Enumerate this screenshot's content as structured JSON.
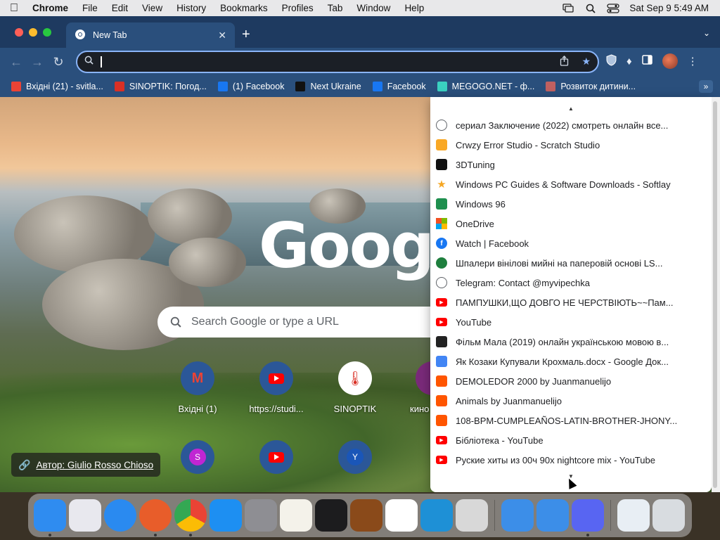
{
  "menubar": {
    "app_name": "Chrome",
    "items": [
      "File",
      "Edit",
      "View",
      "History",
      "Bookmarks",
      "Profiles",
      "Tab",
      "Window",
      "Help"
    ],
    "datetime": "Sat Sep 9  5:49 AM"
  },
  "tab": {
    "title": "New Tab"
  },
  "omnibox": {
    "value": ""
  },
  "bookmarks_bar": [
    {
      "label": "Вхідні (21) - svitla...",
      "icon": "gmail-icon",
      "color": "#ea4335"
    },
    {
      "label": "SINOPTIK: Погод...",
      "icon": "thermometer-icon",
      "color": "#d93025"
    },
    {
      "label": "(1) Facebook",
      "icon": "facebook-icon",
      "color": "#1877f2"
    },
    {
      "label": "Next Ukraine",
      "icon": "next-ukraine-icon",
      "color": "#111111"
    },
    {
      "label": "Facebook",
      "icon": "facebook-icon",
      "color": "#1877f2"
    },
    {
      "label": "MEGOGO.NET - ф...",
      "icon": "megogo-icon",
      "color": "#3ad1c1"
    },
    {
      "label": "Розвиток дитини...",
      "icon": "baby-icon",
      "color": "#c06060"
    }
  ],
  "new_tab_page": {
    "logo": "Google",
    "search_placeholder": "Search Google or type a URL",
    "shortcuts_row1": [
      "Вхідні (1)",
      "https://studi...",
      "SINOPTIK",
      "кино"
    ],
    "shortcuts_row2_initials": [
      "S",
      "Y"
    ],
    "photo_credit": "Автор: Giulio Rosso Chioso"
  },
  "dropdown_items": [
    {
      "label": "сериал Заключение (2022) смотреть онлайн все...",
      "icon": "globe-icon",
      "color": "#5f6368"
    },
    {
      "label": "Crwzy Error Studio - Scratch Studio",
      "icon": "scratch-icon",
      "color": "#f9a825"
    },
    {
      "label": "3DTuning",
      "icon": "3dtuning-icon",
      "color": "#111111"
    },
    {
      "label": "Windows PC Guides & Software Downloads - Softlay",
      "icon": "star-icon",
      "color": "#f5a623"
    },
    {
      "label": "Windows 96",
      "icon": "windows96-icon",
      "color": "#1e8f4e"
    },
    {
      "label": "OneDrive",
      "icon": "microsoft-icon",
      "color": "#f25022"
    },
    {
      "label": "Watch | Facebook",
      "icon": "facebook-icon",
      "color": "#1877f2"
    },
    {
      "label": "Шпалери вінілові мийні на паперовій основі LS...",
      "icon": "green-circle-icon",
      "color": "#1e7f3e"
    },
    {
      "label": "Telegram: Contact @myvipechka",
      "icon": "globe-icon",
      "color": "#5f6368"
    },
    {
      "label": "ПАМПУШКИ,ЩО ДОВГО НЕ ЧЕРСТВІЮТЬ~~Пам...",
      "icon": "youtube-icon",
      "color": "#ff0000"
    },
    {
      "label": "YouTube",
      "icon": "youtube-icon",
      "color": "#ff0000"
    },
    {
      "label": "Фільм Мала (2019) онлайн українською мовою в...",
      "icon": "film-icon",
      "color": "#222222"
    },
    {
      "label": "Як Козаки Купували Крохмаль.docx - Google Док...",
      "icon": "google-docs-icon",
      "color": "#4285f4"
    },
    {
      "label": "DEMOLEDOR 2000 by Juanmanuelijo",
      "icon": "soundcloud-icon",
      "color": "#ff5500"
    },
    {
      "label": "Animals by Juanmanuelijo",
      "icon": "soundcloud-icon",
      "color": "#ff5500"
    },
    {
      "label": "108-BPM-CUMPLEAÑOS-LATIN-BROTHER-JHONY...",
      "icon": "soundcloud-icon",
      "color": "#ff5500"
    },
    {
      "label": "Бібліотека - YouTube",
      "icon": "youtube-icon",
      "color": "#ff0000"
    },
    {
      "label": "Руские хиты из 00ч 90х nightcore mix - YouTube",
      "icon": "youtube-icon",
      "color": "#ff0000"
    }
  ],
  "dock_apps": [
    {
      "name": "finder-icon",
      "color": "#2f8cf0",
      "running": true
    },
    {
      "name": "launchpad-icon",
      "color": "#e8e8ee",
      "running": false
    },
    {
      "name": "safari-icon",
      "color": "#2a8af0",
      "running": false
    },
    {
      "name": "firefox-icon",
      "color": "#e85d2a",
      "running": true
    },
    {
      "name": "chrome-icon",
      "color": "#ffffff",
      "running": true
    },
    {
      "name": "app-store-icon",
      "color": "#1d8ff2",
      "running": false
    },
    {
      "name": "system-settings-icon",
      "color": "#8e8e93",
      "running": false
    },
    {
      "name": "textedit-icon",
      "color": "#f4f2ea",
      "running": false
    },
    {
      "name": "terminal-icon",
      "color": "#1c1c1e",
      "running": false
    },
    {
      "name": "garageband-icon",
      "color": "#8a4a1a",
      "running": false
    },
    {
      "name": "vscode-icon",
      "color": "#ffffff",
      "running": false
    },
    {
      "name": "windows-app-icon",
      "color": "#1e90d6",
      "running": false
    },
    {
      "name": "roblox-icon",
      "color": "#d8d8d8",
      "running": false
    },
    {
      "name": "weather-icon",
      "color": "#3c8ee8",
      "running": false
    },
    {
      "name": "weather-icon",
      "color": "#3c8ee8",
      "running": false
    },
    {
      "name": "discord-icon",
      "color": "#5865f2",
      "running": true
    },
    {
      "name": "downloads-icon",
      "color": "#e8eef4",
      "running": false
    },
    {
      "name": "trash-icon",
      "color": "#d8dce0",
      "running": false
    }
  ]
}
